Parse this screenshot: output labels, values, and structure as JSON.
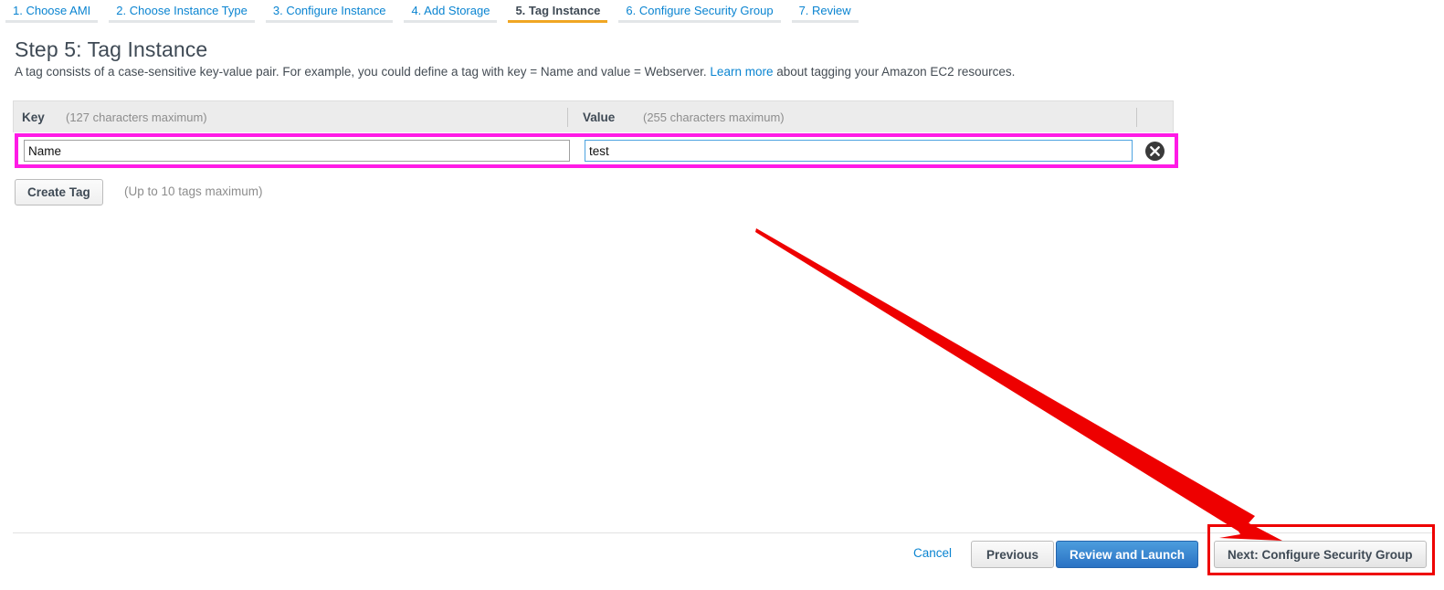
{
  "wizard": {
    "tabs": [
      {
        "label": "1. Choose AMI",
        "active": false
      },
      {
        "label": "2. Choose Instance Type",
        "active": false
      },
      {
        "label": "3. Configure Instance",
        "active": false
      },
      {
        "label": "4. Add Storage",
        "active": false
      },
      {
        "label": "5. Tag Instance",
        "active": true
      },
      {
        "label": "6. Configure Security Group",
        "active": false
      },
      {
        "label": "7. Review",
        "active": false
      }
    ]
  },
  "step": {
    "title": "Step 5: Tag Instance",
    "description_before_link": "A tag consists of a case-sensitive key-value pair. For example, you could define a tag with key = Name and value = Webserver.",
    "link_text": "Learn more",
    "description_after_link": "about tagging your Amazon EC2 resources."
  },
  "tag_table": {
    "key_header": "Key",
    "key_hint": "(127 characters maximum)",
    "value_header": "Value",
    "value_hint": "(255 characters maximum)",
    "rows": [
      {
        "key_value": "Name",
        "key_placeholder": "",
        "value_value": "test",
        "value_placeholder": "",
        "remove_icon": "close-circle-icon"
      }
    ]
  },
  "actions": {
    "create_tag_label": "Create Tag",
    "create_tag_hint": "(Up to 10 tags maximum)"
  },
  "footer": {
    "cancel_label": "Cancel",
    "previous_label": "Previous",
    "review_launch_label": "Review and Launch",
    "next_label": "Next: Configure Security Group"
  },
  "annotations": {
    "highlight_color": "#ff1ae6",
    "callout_color": "#ee0000",
    "active_tab_color": "#f0a623",
    "link_color": "#0a84d1"
  }
}
